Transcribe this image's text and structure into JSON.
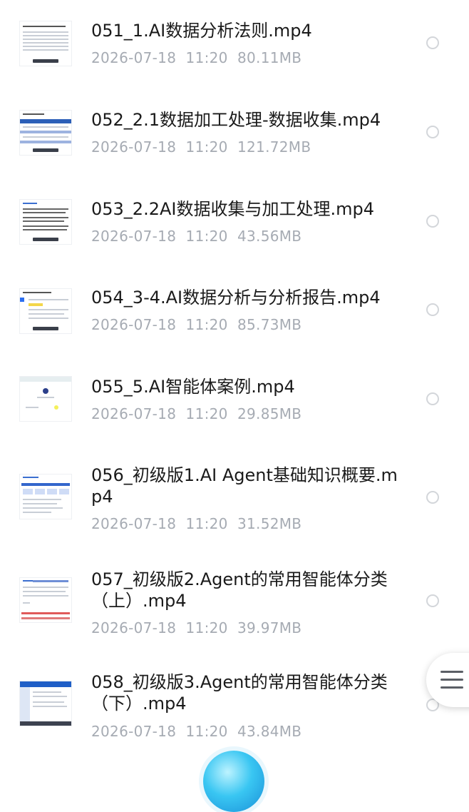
{
  "files": [
    {
      "name": "051_1.AI数据分析法则.mp4",
      "meta": "2026-07-18  11:20  80.11MB"
    },
    {
      "name": "052_2.1数据加工处理-数据收集.mp4",
      "meta": "2026-07-18  11:20  121.72MB"
    },
    {
      "name": "053_2.2AI数据收集与加工处理.mp4",
      "meta": "2026-07-18  11:20  43.56MB"
    },
    {
      "name": "054_3-4.AI数据分析与分析报告.mp4",
      "meta": "2026-07-18  11:20  85.73MB"
    },
    {
      "name": "055_5.AI智能体案例.mp4",
      "meta": "2026-07-18  11:20  29.85MB"
    },
    {
      "name": "056_初级版1.AI Agent基础知识概要.mp4",
      "meta": "2026-07-18  11:20  31.52MB"
    },
    {
      "name": "057_初级版2.Agent的常用智能体分类（上）.mp4",
      "meta": "2026-07-18  11:20  39.97MB"
    },
    {
      "name": "058_初级版3.Agent的常用智能体分类（下）.mp4",
      "meta": "2026-07-18  11:20  43.84MB"
    }
  ],
  "icons": {
    "menu": "hamburger-menu-icon",
    "assistant": "assistant-ball-icon",
    "select": "radio-unchecked-icon"
  },
  "colors": {
    "title": "#1a1a1a",
    "meta": "#a6abb3",
    "radio_border": "#d3d6da",
    "accent": "#39c6f2"
  }
}
